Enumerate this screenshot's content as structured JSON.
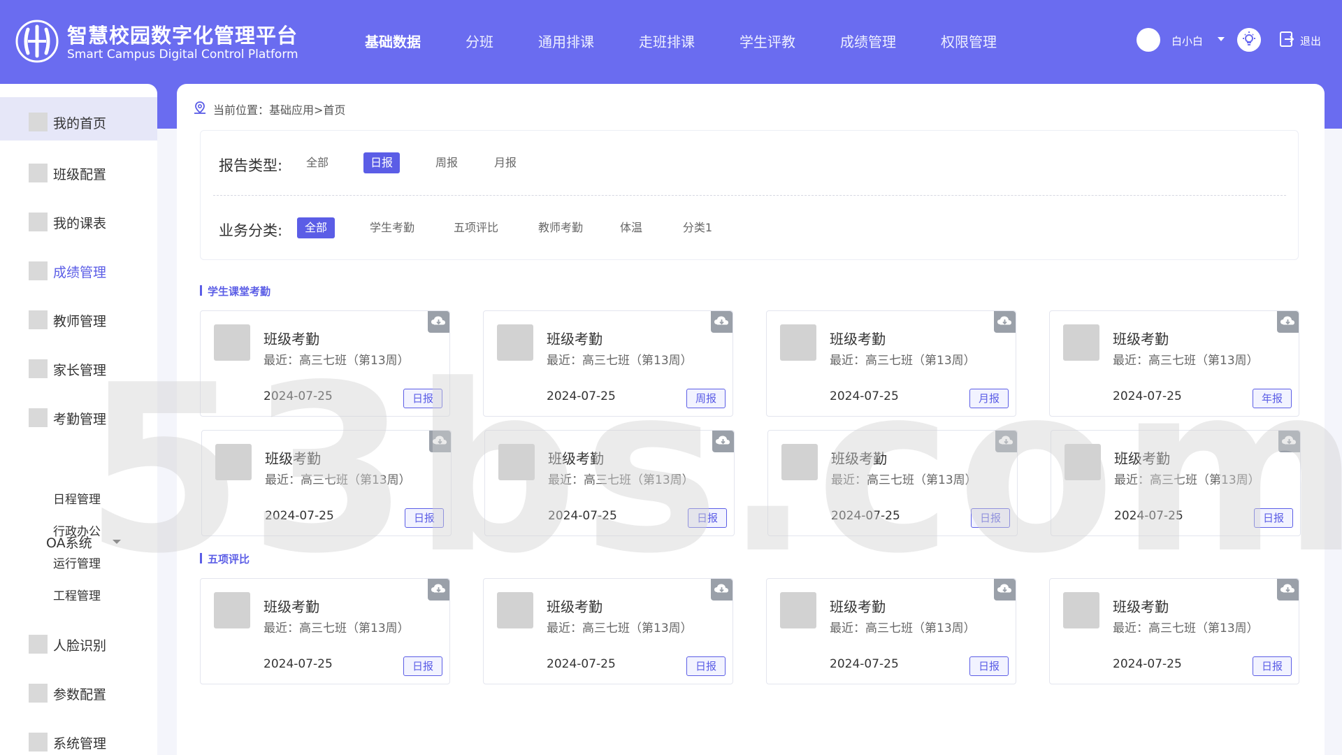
{
  "header": {
    "brand_cn": "智慧校园数字化管理平台",
    "brand_en": "Smart Campus Digital Control Platform",
    "nav": [
      "基础数据",
      "分班",
      "通用排课",
      "走班排课",
      "学生评教",
      "成绩管理",
      "权限管理"
    ],
    "active_nav": "基础数据",
    "username": "白小白",
    "logout": "退出"
  },
  "sidebar": {
    "items": [
      "我的首页",
      "班级配置",
      "我的课表",
      "成绩管理",
      "教师管理",
      "家长管理",
      "考勤管理"
    ],
    "group": "OA系统",
    "sub_items": [
      "日程管理",
      "行政办公",
      "运行管理",
      "工程管理"
    ],
    "items_after": [
      "人脸识别",
      "参数配置",
      "系统管理"
    ]
  },
  "breadcrumb": "当前位置：基础应用>首页",
  "filters": {
    "report_label": "报告类型:",
    "report_options": [
      "全部",
      "日报",
      "周报",
      "月报"
    ],
    "report_active": "日报",
    "business_label": "业务分类:",
    "business_options": [
      "全部",
      "学生考勤",
      "五项评比",
      "教师考勤",
      "体温",
      "分类1"
    ],
    "business_active": "全部"
  },
  "sections": [
    {
      "title": "学生课堂考勤",
      "cards": [
        {
          "title": "班级考勤",
          "sub": "最近：高三七班（第13周）",
          "date": "2024-07-25",
          "tag": "日报"
        },
        {
          "title": "班级考勤",
          "sub": "最近：高三七班（第13周）",
          "date": "2024-07-25",
          "tag": "周报"
        },
        {
          "title": "班级考勤",
          "sub": "最近：高三七班（第13周）",
          "date": "2024-07-25",
          "tag": "月报"
        },
        {
          "title": "班级考勤",
          "sub": "最近：高三七班（第13周）",
          "date": "2024-07-25",
          "tag": "年报"
        },
        {
          "title": "班级考勤",
          "sub": "最近：高三七班（第13周）",
          "date": "2024-07-25",
          "tag": "日报"
        },
        {
          "title": "班级考勤",
          "sub": "最近：高三七班（第13周）",
          "date": "2024-07-25",
          "tag": "日报"
        },
        {
          "title": "班级考勤",
          "sub": "最近：高三七班（第13周）",
          "date": "2024-07-25",
          "tag": "日报"
        },
        {
          "title": "班级考勤",
          "sub": "最近：高三七班（第13周）",
          "date": "2024-07-25",
          "tag": "日报"
        }
      ]
    },
    {
      "title": "五项评比",
      "cards": [
        {
          "title": "班级考勤",
          "sub": "最近：高三七班（第13周）",
          "date": "2024-07-25",
          "tag": "日报"
        },
        {
          "title": "班级考勤",
          "sub": "最近：高三七班（第13周）",
          "date": "2024-07-25",
          "tag": "日报"
        },
        {
          "title": "班级考勤",
          "sub": "最近：高三七班（第13周）",
          "date": "2024-07-25",
          "tag": "日报"
        },
        {
          "title": "班级考勤",
          "sub": "最近：高三七班（第13周）",
          "date": "2024-07-25",
          "tag": "日报"
        }
      ]
    }
  ],
  "watermark": "53bs.com",
  "colors": {
    "primary": "#6a6cf0",
    "accent": "#5b5de6"
  }
}
